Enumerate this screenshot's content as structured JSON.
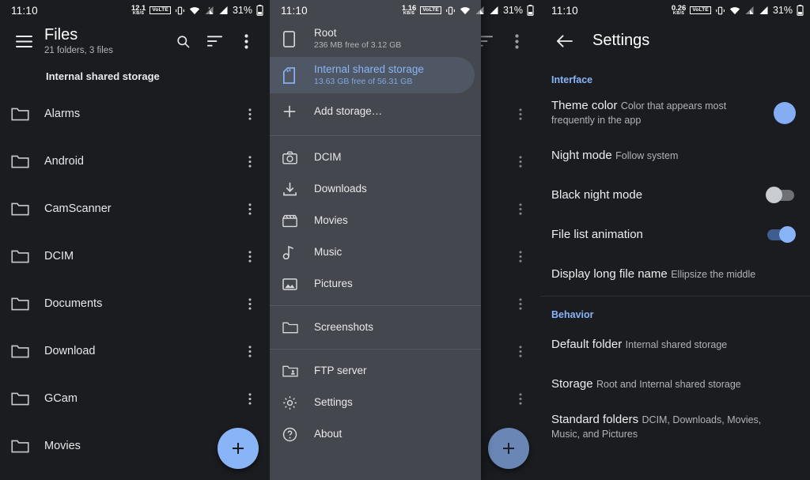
{
  "theme": {
    "accent": "#8ab4f8",
    "fab_bg": "#8ab4f8",
    "fab_fg": "#15181c",
    "list_bg": "#1a1c20",
    "drawer_bg": "#44474d",
    "selected_pill_bg": "#4e5763",
    "swatch_color": "#85aef2"
  },
  "statusbar": {
    "clock": "11:10",
    "battery_pct": "31%",
    "rate_unit": "KB/S",
    "volte_label": "VoLTE",
    "panel1_rate": "12.1",
    "panel2_rate": "1.16",
    "panel3_rate": "0.26"
  },
  "files_screen": {
    "menu_icon": "hamburger-menu-icon",
    "title": "Files",
    "subtitle": "21 folders, 3 files",
    "search_icon": "search-icon",
    "sort_icon": "sort-icon",
    "overflow_icon": "overflow-menu-icon",
    "breadcrumb": "Internal shared storage",
    "fab_label": "+",
    "rows": [
      {
        "name": "Alarms",
        "icon": "folder-icon"
      },
      {
        "name": "Android",
        "icon": "folder-icon"
      },
      {
        "name": "CamScanner",
        "icon": "folder-icon"
      },
      {
        "name": "DCIM",
        "icon": "folder-icon"
      },
      {
        "name": "Documents",
        "icon": "folder-icon"
      },
      {
        "name": "Download",
        "icon": "folder-icon"
      },
      {
        "name": "GCam",
        "icon": "folder-icon"
      },
      {
        "name": "Movies",
        "icon": "folder-icon"
      }
    ]
  },
  "drawer_screen": {
    "storages": [
      {
        "label": "Root",
        "sub": "236 MB free of 3.12 GB",
        "icon": "phone-icon",
        "selected": false
      },
      {
        "label": "Internal shared storage",
        "sub": "13.63 GB free of 56.31 GB",
        "icon": "sdcard-icon",
        "selected": true
      }
    ],
    "add_storage": {
      "label": "Add storage…",
      "icon": "plus-icon"
    },
    "shortcuts": [
      {
        "label": "DCIM",
        "icon": "camera-icon"
      },
      {
        "label": "Downloads",
        "icon": "download-icon"
      },
      {
        "label": "Movies",
        "icon": "movie-icon"
      },
      {
        "label": "Music",
        "icon": "music-note-icon"
      },
      {
        "label": "Pictures",
        "icon": "image-icon"
      }
    ],
    "screenshots": {
      "label": "Screenshots",
      "icon": "folder-icon"
    },
    "tools": [
      {
        "label": "FTP server",
        "icon": "ftp-folder-icon"
      },
      {
        "label": "Settings",
        "icon": "gear-icon"
      },
      {
        "label": "About",
        "icon": "help-circle-icon"
      }
    ]
  },
  "settings_screen": {
    "back_icon": "back-arrow-icon",
    "title": "Settings",
    "sections": [
      {
        "header": "Interface",
        "rows": [
          {
            "title": "Theme color",
            "sub": "Color that appears most frequently in the app",
            "control": "swatch"
          },
          {
            "title": "Night mode",
            "sub": "Follow system",
            "control": "none"
          },
          {
            "title": "Black night mode",
            "sub": "",
            "control": "switch-off"
          },
          {
            "title": "File list animation",
            "sub": "",
            "control": "switch-on"
          },
          {
            "title": "Display long file name",
            "sub": "Ellipsize the middle",
            "control": "none"
          }
        ]
      },
      {
        "header": "Behavior",
        "rows": [
          {
            "title": "Default folder",
            "sub": "Internal shared storage",
            "control": "none"
          },
          {
            "title": "Storage",
            "sub": "Root and Internal shared storage",
            "control": "none"
          },
          {
            "title": "Standard folders",
            "sub": "DCIM, Downloads, Movies, Music, and Pictures",
            "control": "none"
          }
        ]
      }
    ]
  }
}
